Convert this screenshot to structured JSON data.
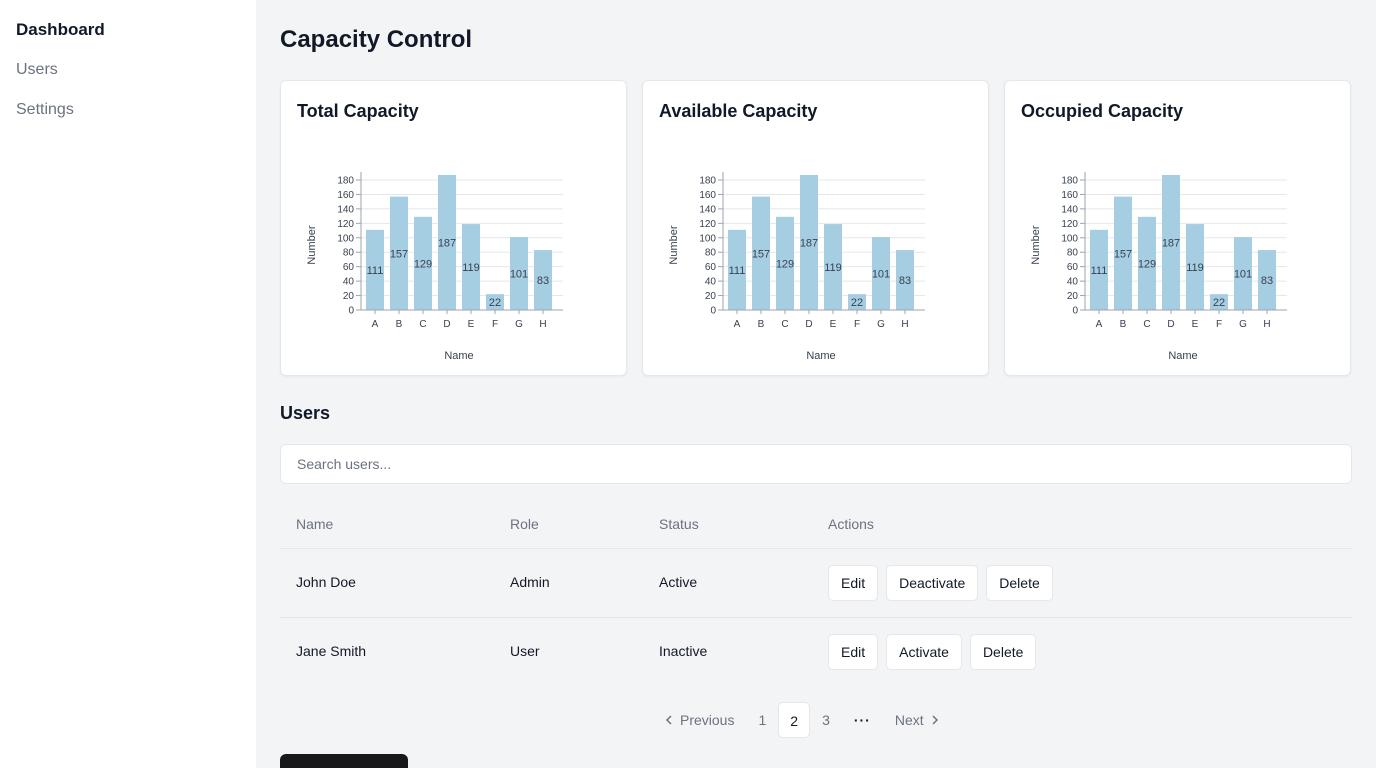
{
  "sidebar": {
    "items": [
      {
        "label": "Dashboard"
      },
      {
        "label": "Users"
      },
      {
        "label": "Settings"
      }
    ]
  },
  "page": {
    "title": "Capacity Control"
  },
  "charts": {
    "titles": [
      "Total Capacity",
      "Available Capacity",
      "Occupied Capacity"
    ]
  },
  "chart_data": [
    {
      "type": "bar",
      "title": "Total Capacity",
      "xlabel": "Name",
      "ylabel": "Number",
      "categories": [
        "A",
        "B",
        "C",
        "D",
        "E",
        "F",
        "G",
        "H"
      ],
      "values": [
        111,
        157,
        129,
        187,
        119,
        22,
        101,
        83
      ],
      "ylim": [
        0,
        180
      ],
      "yticks": [
        0,
        20,
        40,
        60,
        80,
        100,
        120,
        140,
        160,
        180
      ],
      "color": "#a6cee3",
      "grid": true
    },
    {
      "type": "bar",
      "title": "Available Capacity",
      "xlabel": "Name",
      "ylabel": "Number",
      "categories": [
        "A",
        "B",
        "C",
        "D",
        "E",
        "F",
        "G",
        "H"
      ],
      "values": [
        111,
        157,
        129,
        187,
        119,
        22,
        101,
        83
      ],
      "ylim": [
        0,
        180
      ],
      "yticks": [
        0,
        20,
        40,
        60,
        80,
        100,
        120,
        140,
        160,
        180
      ],
      "color": "#a6cee3",
      "grid": true
    },
    {
      "type": "bar",
      "title": "Occupied Capacity",
      "xlabel": "Name",
      "ylabel": "Number",
      "categories": [
        "A",
        "B",
        "C",
        "D",
        "E",
        "F",
        "G",
        "H"
      ],
      "values": [
        111,
        157,
        129,
        187,
        119,
        22,
        101,
        83
      ],
      "ylim": [
        0,
        180
      ],
      "yticks": [
        0,
        20,
        40,
        60,
        80,
        100,
        120,
        140,
        160,
        180
      ],
      "color": "#a6cee3",
      "grid": true
    }
  ],
  "users": {
    "title": "Users",
    "search_placeholder": "Search users...",
    "columns": [
      "Name",
      "Role",
      "Status",
      "Actions"
    ],
    "rows": [
      {
        "name": "John Doe",
        "role": "Admin",
        "status": "Active",
        "actions": [
          "Edit",
          "Deactivate",
          "Delete"
        ]
      },
      {
        "name": "Jane Smith",
        "role": "User",
        "status": "Inactive",
        "actions": [
          "Edit",
          "Activate",
          "Delete"
        ]
      }
    ]
  },
  "pagination": {
    "previous": "Previous",
    "pages": [
      "1",
      "2",
      "3"
    ],
    "current": "2",
    "ellipsis": "···",
    "next": "Next"
  }
}
